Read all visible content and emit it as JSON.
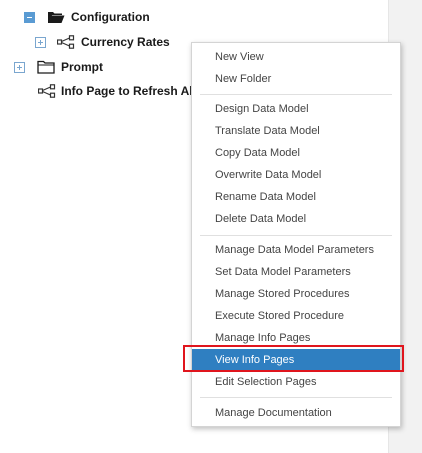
{
  "tree": {
    "items": [
      {
        "label": "Configuration",
        "state": "expanded",
        "icon": "folder-open-icon"
      },
      {
        "label": "Currency Rates",
        "state": "collapsed",
        "icon": "data-model-icon"
      },
      {
        "label": "Prompt",
        "state": "collapsed",
        "icon": "folder-closed-icon"
      },
      {
        "label": "Info Page to Refresh All '",
        "state": "leaf",
        "icon": "data-model-icon"
      }
    ]
  },
  "context_menu": {
    "groups": [
      [
        "New View",
        "New Folder"
      ],
      [
        "Design Data Model",
        "Translate Data Model",
        "Copy Data Model",
        "Overwrite Data Model",
        "Rename Data Model",
        "Delete Data Model"
      ],
      [
        "Manage Data Model Parameters",
        "Set Data Model Parameters",
        "Manage Stored Procedures",
        "Execute Stored Procedure",
        "Manage Info Pages",
        "View Info Pages",
        "Edit Selection Pages"
      ],
      [
        "Manage Documentation"
      ]
    ],
    "selected": "View Info Pages"
  },
  "colors": {
    "selected_bg": "#2f7fc1",
    "highlight_border": "#e0151d",
    "expander_blue": "#5a9bd3"
  }
}
